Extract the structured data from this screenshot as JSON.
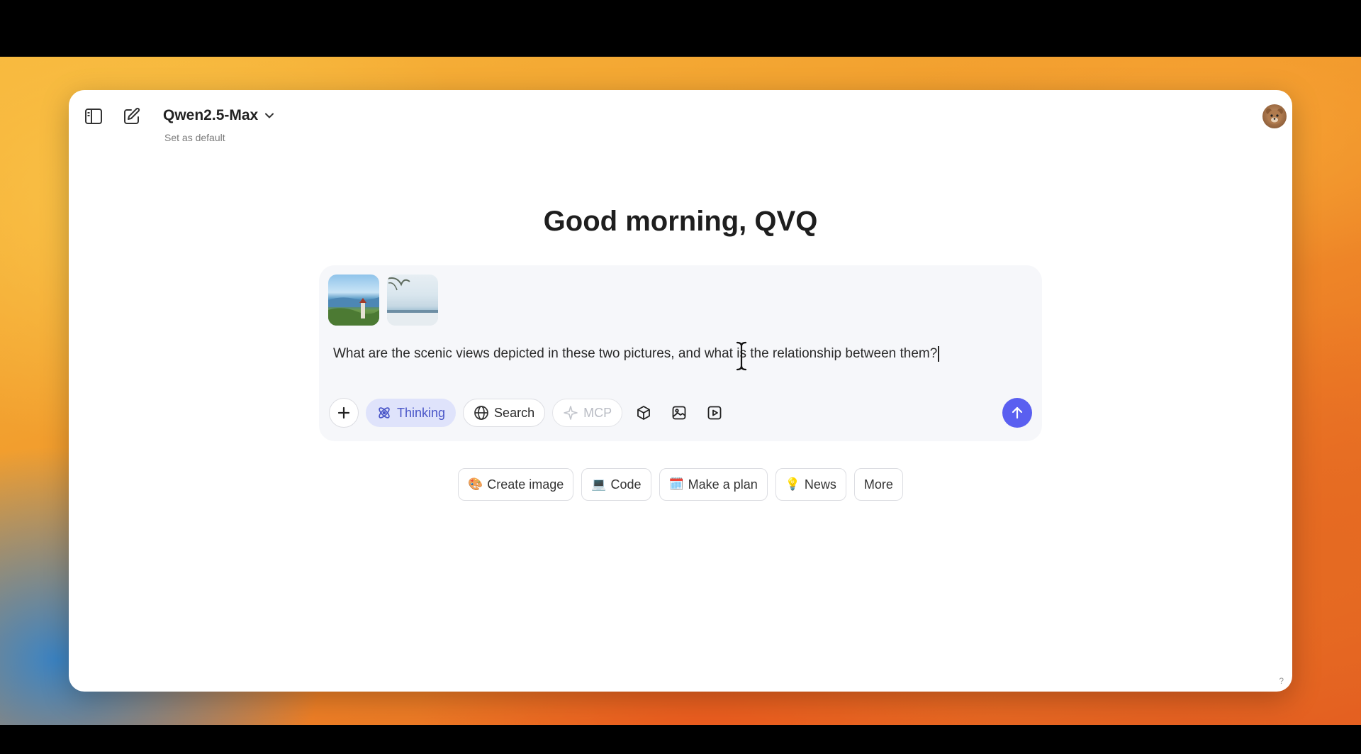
{
  "header": {
    "model_name": "Qwen2.5-Max",
    "set_default_label": "Set as default"
  },
  "main": {
    "greeting": "Good morning, QVQ"
  },
  "composer": {
    "prompt": "What are the scenic views depicted in these two pictures, and what is the relationship between them?",
    "tools": {
      "thinking_label": "Thinking",
      "search_label": "Search",
      "mcp_label": "MCP"
    }
  },
  "suggestions": [
    {
      "emoji": "🎨",
      "label": "Create image"
    },
    {
      "emoji": "💻",
      "label": "Code"
    },
    {
      "emoji": "🗓️",
      "label": "Make a plan"
    },
    {
      "emoji": "💡",
      "label": "News"
    },
    {
      "emoji": "",
      "label": "More"
    }
  ],
  "footer": {
    "help_mark": "?"
  },
  "colors": {
    "accent": "#5a5ff0",
    "thinking_bg": "#dfe3fb",
    "thinking_text": "#4a56c8"
  },
  "icons": {
    "sidebar_toggle": "sidebar-icon",
    "new_chat": "edit-icon",
    "attach": "plus-icon",
    "thinking": "atom-icon",
    "search": "globe-icon",
    "mcp": "sparkle-icon",
    "artifacts": "cube-icon",
    "image": "image-icon",
    "video": "video-icon",
    "send": "arrow-up-icon"
  }
}
